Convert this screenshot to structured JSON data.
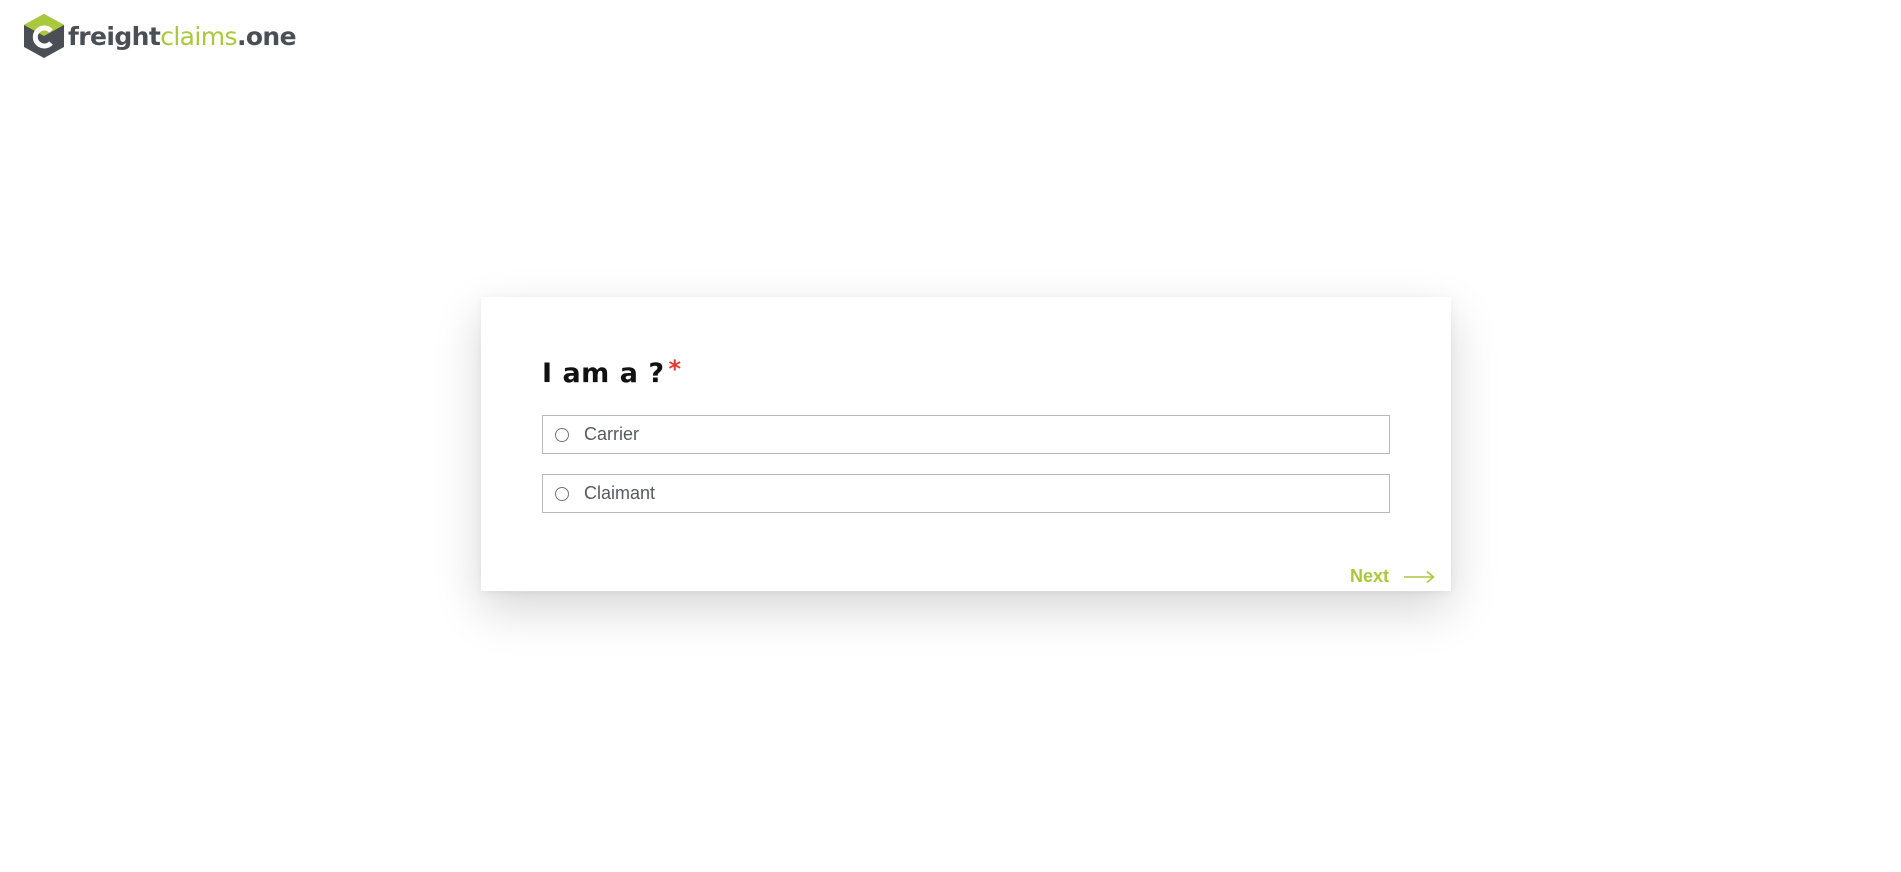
{
  "brand": {
    "name_part1": "freight",
    "name_part2": "claims",
    "name_part3": ".one",
    "colors": {
      "dark": "#4a4f55",
      "accent": "#a9c93a"
    },
    "logo_icon": "hexagon-c-logo-icon"
  },
  "form": {
    "question": "I am a ?",
    "required_mark": "*",
    "options": [
      {
        "label": "Carrier",
        "selected": false
      },
      {
        "label": "Claimant",
        "selected": false
      }
    ],
    "next_label": "Next",
    "next_icon": "arrow-right-icon"
  }
}
